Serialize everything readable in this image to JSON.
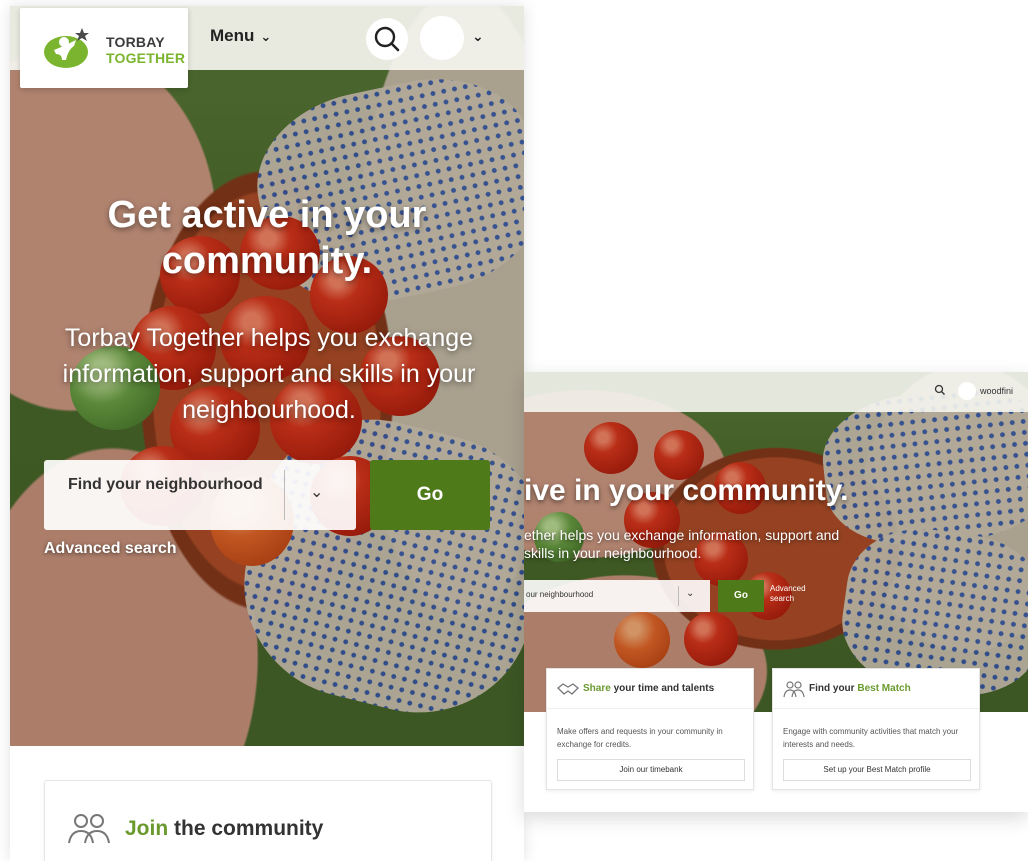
{
  "mobile": {
    "logo": {
      "line1": "TORBAY",
      "line2": "TOGETHER"
    },
    "menu_label": "Menu",
    "hero": {
      "title": "Get active in your community.",
      "subtitle": "Torbay Together helps you exchange information, support and skills in your neighbourhood.",
      "neighbourhood_select": "Find your neighbourhood",
      "go_label": "Go",
      "advanced_search": "Advanced search"
    },
    "join_card": {
      "highlight": "Join",
      "rest": " the community"
    }
  },
  "desktop": {
    "username": "woodfini",
    "hero": {
      "title": "ive in your community.",
      "subtitle": "ether helps you exchange information, support and skills in your neighbourhood.",
      "neighbourhood_select": "our neighbourhood",
      "go_label": "Go",
      "advanced_search": "Advanced search"
    },
    "cards": [
      {
        "highlight": "Share",
        "rest": " your time and talents",
        "body": "Make offers and requests in your community in exchange for credits.",
        "button": "Join our timebank"
      },
      {
        "prefix": "Find your ",
        "highlight": "Best Match",
        "body": "Engage with community activities that match your interests and needs.",
        "button": "Set up your Best Match profile"
      }
    ]
  },
  "colors": {
    "brand_green": "#7bb52f",
    "go_button": "#4f7a1a",
    "brand_dark": "#3c3c3c"
  },
  "icons": [
    "logo-person-icon",
    "search-icon",
    "chevron-down-icon",
    "user-avatar",
    "handshake-icon",
    "people-icon"
  ]
}
